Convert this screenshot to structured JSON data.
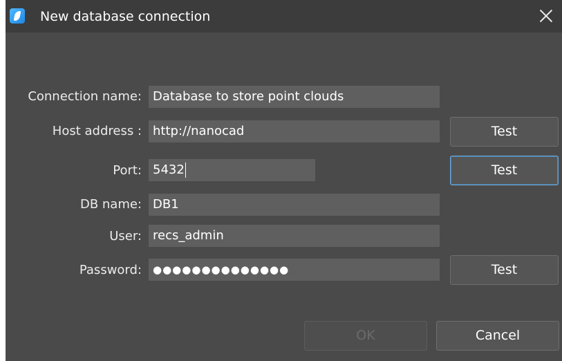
{
  "window": {
    "title": "New database connection",
    "app_icon": "nanocad-icon",
    "close_icon": "close-icon"
  },
  "form": {
    "connection_name": {
      "label": "Connection name:",
      "value": "Database to store point clouds"
    },
    "host_address": {
      "label": "Host address :",
      "value": "http://nanocad",
      "test_label": "Test"
    },
    "port": {
      "label": "Port:",
      "value": "5432",
      "test_label": "Test"
    },
    "db_name": {
      "label": "DB name:",
      "value": "DB1"
    },
    "user": {
      "label": "User:",
      "value": "recs_admin"
    },
    "password": {
      "label": "Password:",
      "value": "●●●●●●●●●●●●●●",
      "test_label": "Test"
    }
  },
  "footer": {
    "ok_label": "OK",
    "cancel_label": "Cancel"
  }
}
